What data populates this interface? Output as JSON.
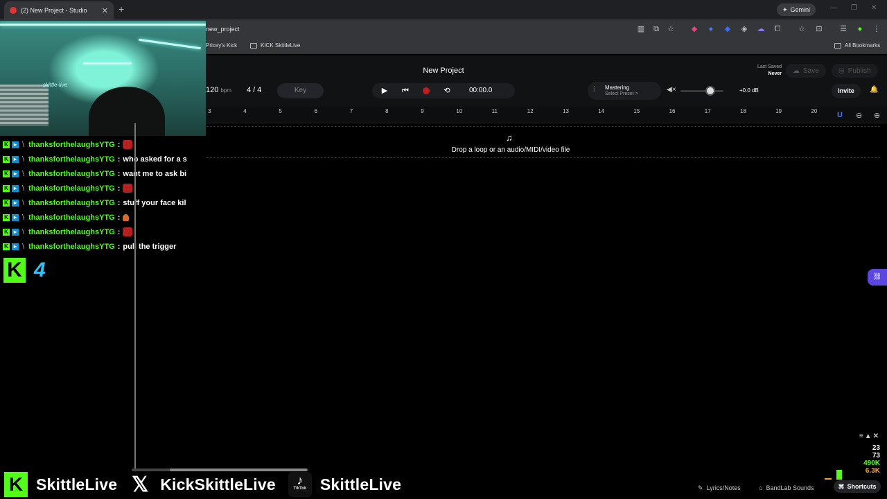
{
  "browser": {
    "tab_title": "(2) New Project - Studio",
    "tab_close": "✕",
    "new_tab": "+",
    "gemini_label": "Gemini",
    "url": "new_project",
    "bookmarks": [
      {
        "label": "Pricey's Kick"
      },
      {
        "label": "KICK  SkittleLive"
      }
    ],
    "all_bookmarks": "All Bookmarks",
    "window_controls": [
      "—",
      "❐",
      "✕"
    ]
  },
  "studio": {
    "project_title": "New Project",
    "last_saved_label": "Last Saved",
    "last_saved_value": "Never",
    "save_label": "Save",
    "publish_label": "Publish",
    "tempo": "120",
    "tempo_unit": "bpm",
    "time_sig": "4 / 4",
    "key_label": "Key",
    "timecode": "00:00.0",
    "mastering_label": "Mastering",
    "mastering_preset": "Select Preset >",
    "volume_db": "+0.0 dB",
    "volume_level": 0.7,
    "invite_label": "Invite",
    "ruler_marks": [
      "3",
      "4",
      "5",
      "6",
      "7",
      "8",
      "9",
      "10",
      "11",
      "12",
      "13",
      "14",
      "15",
      "16",
      "17",
      "18",
      "19",
      "20"
    ],
    "drop_text": "Drop a loop or an audio/MIDI/video file",
    "lyrics_label": "Lyrics/Notes",
    "sounds_label": "BandLab Sounds",
    "shortcuts_label": "Shortcuts"
  },
  "overlay": {
    "chat": [
      {
        "user": "thanksforthelaughsYTG",
        "msg": "",
        "emote": "red"
      },
      {
        "user": "thanksforthelaughsYTG",
        "msg": "who asked for a s",
        "emote": ""
      },
      {
        "user": "thanksforthelaughsYTG",
        "msg": "want me to ask bi",
        "emote": ""
      },
      {
        "user": "thanksforthelaughsYTG",
        "msg": "",
        "emote": "red"
      },
      {
        "user": "thanksforthelaughsYTG",
        "msg": "stuff your face kil",
        "emote": ""
      },
      {
        "user": "thanksforthelaughsYTG",
        "msg": "",
        "emote": "small"
      },
      {
        "user": "thanksforthelaughsYTG",
        "msg": "",
        "emote": "red"
      },
      {
        "user": "thanksforthelaughsYTG",
        "msg": "pull the trigger",
        "emote": ""
      }
    ],
    "chat_separator": ":",
    "viewer_count": "4",
    "webcam_sign": "skittle-live",
    "socials": [
      {
        "platform": "kick",
        "name": "SkittleLive"
      },
      {
        "platform": "x",
        "name": "KickSkittleLive"
      },
      {
        "platform": "tiktok",
        "name": "SkittleLive",
        "badge": "TikTok"
      }
    ],
    "stats": {
      "s1": "23",
      "s2": "73",
      "s3": "490K",
      "s4": "6.3K"
    }
  },
  "colors": {
    "kick_green": "#53fc18",
    "record_red": "#c01d1d",
    "accent_purple": "#5b47e0"
  }
}
